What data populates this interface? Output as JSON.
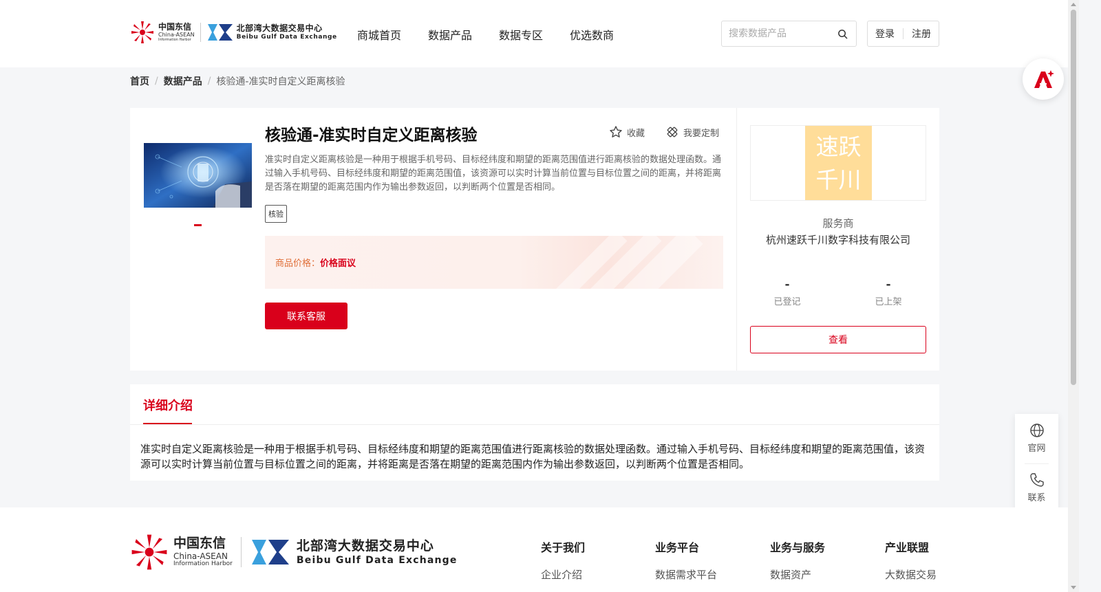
{
  "header": {
    "logo_cn_title": "中国东信",
    "logo_cn_sub": "China-ASEAN",
    "logo_cn_sub2": "Information Harbor",
    "logo_bb_title": "北部湾大数据交易中心",
    "logo_bb_sub": "Beibu Gulf Data Exchange",
    "nav": [
      "商城首页",
      "数据产品",
      "数据专区",
      "优选数商"
    ],
    "search_placeholder": "搜索数据产品",
    "login": "登录",
    "register": "注册"
  },
  "breadcrumb": {
    "home": "首页",
    "products": "数据产品",
    "current": "核验通-准实时自定义距离核验"
  },
  "product": {
    "title": "核验通-准实时自定义距离核验",
    "favorite": "收藏",
    "customize": "我要定制",
    "description": "准实时自定义距离核验是一种用于根据手机号码、目标经纬度和期望的距离范围值进行距离核验的数据处理函数。通过输入手机号码、目标经纬度和期望的距离范围值，该资源可以实时计算当前位置与目标位置之间的距离，并将距离是否落在期望的距离范围内作为输出参数返回，以判断两个位置是否相同。",
    "tag": "核验",
    "price_label": "商品价格：",
    "price_value": "价格面议",
    "contact_button": "联系客服"
  },
  "vendor": {
    "logo_text_1": "速跃",
    "logo_text_2": "千川",
    "role": "服务商",
    "name": "杭州速跃千川数字科技有限公司",
    "registered_value": "-",
    "registered_label": "已登记",
    "listed_value": "-",
    "listed_label": "已上架",
    "view_button": "查看"
  },
  "detail": {
    "tab": "详细介绍",
    "body": "准实时自定义距离核验是一种用于根据手机号码、目标经纬度和期望的距离范围值进行距离核验的数据处理函数。通过输入手机号码、目标经纬度和期望的距离范围值，该资源可以实时计算当前位置与目标位置之间的距离，并将距离是否落在期望的距离范围内作为输出参数返回，以判断两个位置是否相同。"
  },
  "sidebar": {
    "website": "官网",
    "contact": "联系"
  },
  "footer": {
    "columns": [
      {
        "heading": "关于我们",
        "link": "企业介绍"
      },
      {
        "heading": "业务平台",
        "link": "数据需求平台"
      },
      {
        "heading": "业务与服务",
        "link": "数据资产"
      },
      {
        "heading": "产业联盟",
        "link": "大数据交易"
      }
    ]
  },
  "colors": {
    "brand_red": "#d9001b",
    "vendor_logo_bg": "#ffdd99",
    "price_text": "#e0703a"
  }
}
